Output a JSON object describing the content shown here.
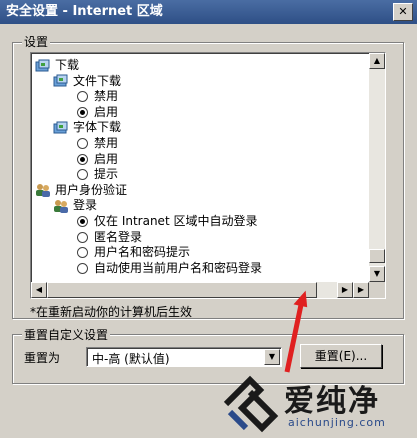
{
  "window": {
    "title": "安全设置 - Internet 区域",
    "close_label": "✕"
  },
  "settings_group": {
    "label": "设置",
    "tree": [
      {
        "indent": 0,
        "kind": "folder",
        "label": "下载"
      },
      {
        "indent": 1,
        "kind": "folder",
        "label": "文件下载"
      },
      {
        "indent": 2,
        "kind": "radio",
        "checked": false,
        "label": "禁用"
      },
      {
        "indent": 2,
        "kind": "radio",
        "checked": true,
        "label": "启用"
      },
      {
        "indent": 1,
        "kind": "folder",
        "label": "字体下载"
      },
      {
        "indent": 2,
        "kind": "radio",
        "checked": false,
        "label": "禁用"
      },
      {
        "indent": 2,
        "kind": "radio",
        "checked": true,
        "label": "启用"
      },
      {
        "indent": 2,
        "kind": "radio",
        "checked": false,
        "label": "提示"
      },
      {
        "indent": 0,
        "kind": "users",
        "label": "用户身份验证"
      },
      {
        "indent": 1,
        "kind": "users",
        "label": "登录"
      },
      {
        "indent": 2,
        "kind": "radio",
        "checked": true,
        "label": "仅在 Intranet 区域中自动登录"
      },
      {
        "indent": 2,
        "kind": "radio",
        "checked": false,
        "label": "匿名登录"
      },
      {
        "indent": 2,
        "kind": "radio",
        "checked": false,
        "label": "用户名和密码提示"
      },
      {
        "indent": 2,
        "kind": "radio",
        "checked": false,
        "label": "自动使用当前用户名和密码登录"
      }
    ],
    "note": "*在重新启动你的计算机后生效"
  },
  "reset_group": {
    "label": "重置自定义设置",
    "reset_to_label": "重置为",
    "selected_level": "中-高 (默认值)",
    "reset_button": "重置(E)..."
  },
  "watermark": {
    "text": "爱纯净",
    "url": "aichunjing.com"
  },
  "colors": {
    "titlebar": "#2e4f86",
    "dialog": "#d4d0c8",
    "accent_red": "#e02020"
  }
}
